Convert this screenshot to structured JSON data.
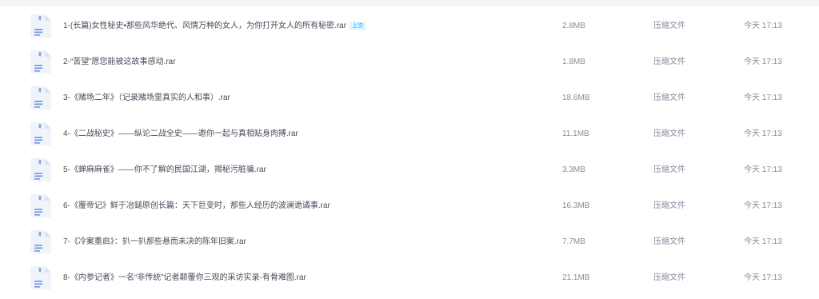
{
  "files": [
    {
      "name": "1-(长篇)女性秘史•那些风华绝代、风情万种的女人，为你打开女人的所有秘密.rar",
      "badge": "上次",
      "size": "2.8MB",
      "type": "压缩文件",
      "time": "今天 17:13",
      "icon": "archive-file-icon"
    },
    {
      "name": "2-“苦望”愿您能被这故事感动.rar",
      "size": "1.8MB",
      "type": "压缩文件",
      "time": "今天 17:13",
      "icon": "archive-file-icon"
    },
    {
      "name": "3-《赌场二年》（记录赌场里真实的人和事）.rar",
      "size": "18.6MB",
      "type": "压缩文件",
      "time": "今天 17:13",
      "icon": "archive-file-icon"
    },
    {
      "name": "4-《二战秘史》——纵论二战全史——邀你一起与真相贴身肉搏.rar",
      "size": "11.1MB",
      "type": "压缩文件",
      "time": "今天 17:13",
      "icon": "archive-file-icon"
    },
    {
      "name": "5-《蝉麻麻雀》——你不了解的民国江湖，揭秘污脏骗.rar",
      "size": "3.3MB",
      "type": "压缩文件",
      "time": "今天 17:13",
      "icon": "archive-file-icon"
    },
    {
      "name": "6-《覆帝记》鲜于冶鎚原创长篇：天下巨变时，那些人经历的波澜诡谲事.rar",
      "size": "16.3MB",
      "type": "压缩文件",
      "time": "今天 17:13",
      "icon": "archive-file-icon"
    },
    {
      "name": "7-《冷案重启》：扒一扒那些悬而未决的陈年旧案.rar",
      "size": "7.7MB",
      "type": "压缩文件",
      "time": "今天 17:13",
      "icon": "archive-file-icon"
    },
    {
      "name": "8-《内参记者》一名“非传统”记者颠覆你三观的采访实录-有骨难图.rar",
      "size": "21.1MB",
      "type": "压缩文件",
      "time": "今天 17:13",
      "icon": "archive-file-icon"
    }
  ],
  "colors": {
    "icon_body": "#f0f3fa",
    "icon_fold": "#dce3f0",
    "icon_lines": "#6f96d8",
    "badge_text": "#06a7ff",
    "badge_bg": "#e3f3ff"
  }
}
